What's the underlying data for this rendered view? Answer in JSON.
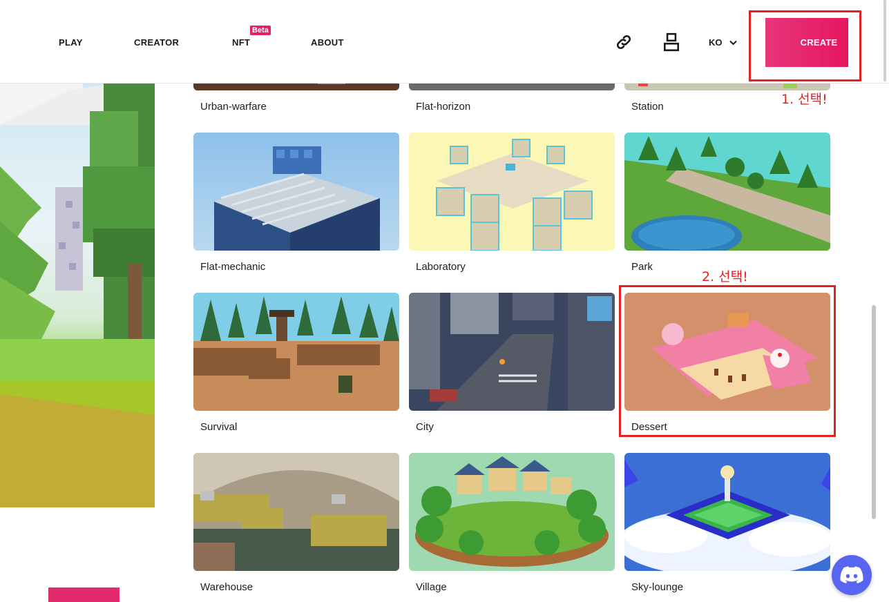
{
  "nav": {
    "play": "PLAY",
    "creator": "CREATOR",
    "nft": "NFT",
    "nft_badge": "Beta",
    "about": "ABOUT"
  },
  "header": {
    "language": "KO",
    "create_label": "CREATE",
    "link_icon": "link-icon",
    "profile_icon": "user-icon",
    "lang_chevron_icon": "chevron-down-icon"
  },
  "annotations": {
    "step1": "1. 선택!",
    "step2": "2. 선택!"
  },
  "templates": {
    "row0": [
      "Urban-warfare",
      "Flat-horizon",
      "Station"
    ],
    "row1": [
      "Flat-mechanic",
      "Laboratory",
      "Park"
    ],
    "row2": [
      "Survival",
      "City",
      "Dessert"
    ],
    "row3": [
      "Warehouse",
      "Village",
      "Sky-lounge"
    ]
  },
  "colors": {
    "accent": "#e5175e",
    "annotation": "#e52020",
    "discord": "#5865f2"
  },
  "floating": {
    "discord_icon": "discord-icon"
  }
}
